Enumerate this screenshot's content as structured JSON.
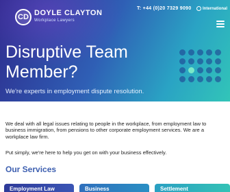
{
  "header": {
    "logo_mark": "CD",
    "logo_name": "DOYLE CLAYTON",
    "logo_tagline": "Workplace Lawyers",
    "phone": "T: +44 (0)20 7329 9090",
    "international_label": "International"
  },
  "hero": {
    "title": "Disruptive Team Member?",
    "subtitle": "We're experts in employment dispute resolution."
  },
  "intro": {
    "paragraph_1": "We deal with all legal issues relating to people in the workplace, from employment law to business immigration, from pensions to other corporate employment services. We are a workplace law firm.",
    "paragraph_2": "Put simply, we're here to help you get on with your business effectively."
  },
  "services": {
    "heading": "Our Services",
    "cards": [
      "Employment Law",
      "Business",
      "Settlement"
    ]
  },
  "colors": {
    "hero_gradient_start": "#2d2a8c",
    "hero_gradient_end": "#32c5b8",
    "heading_blue": "#3d5fb0",
    "dot_accent": "#7ae8c8"
  }
}
